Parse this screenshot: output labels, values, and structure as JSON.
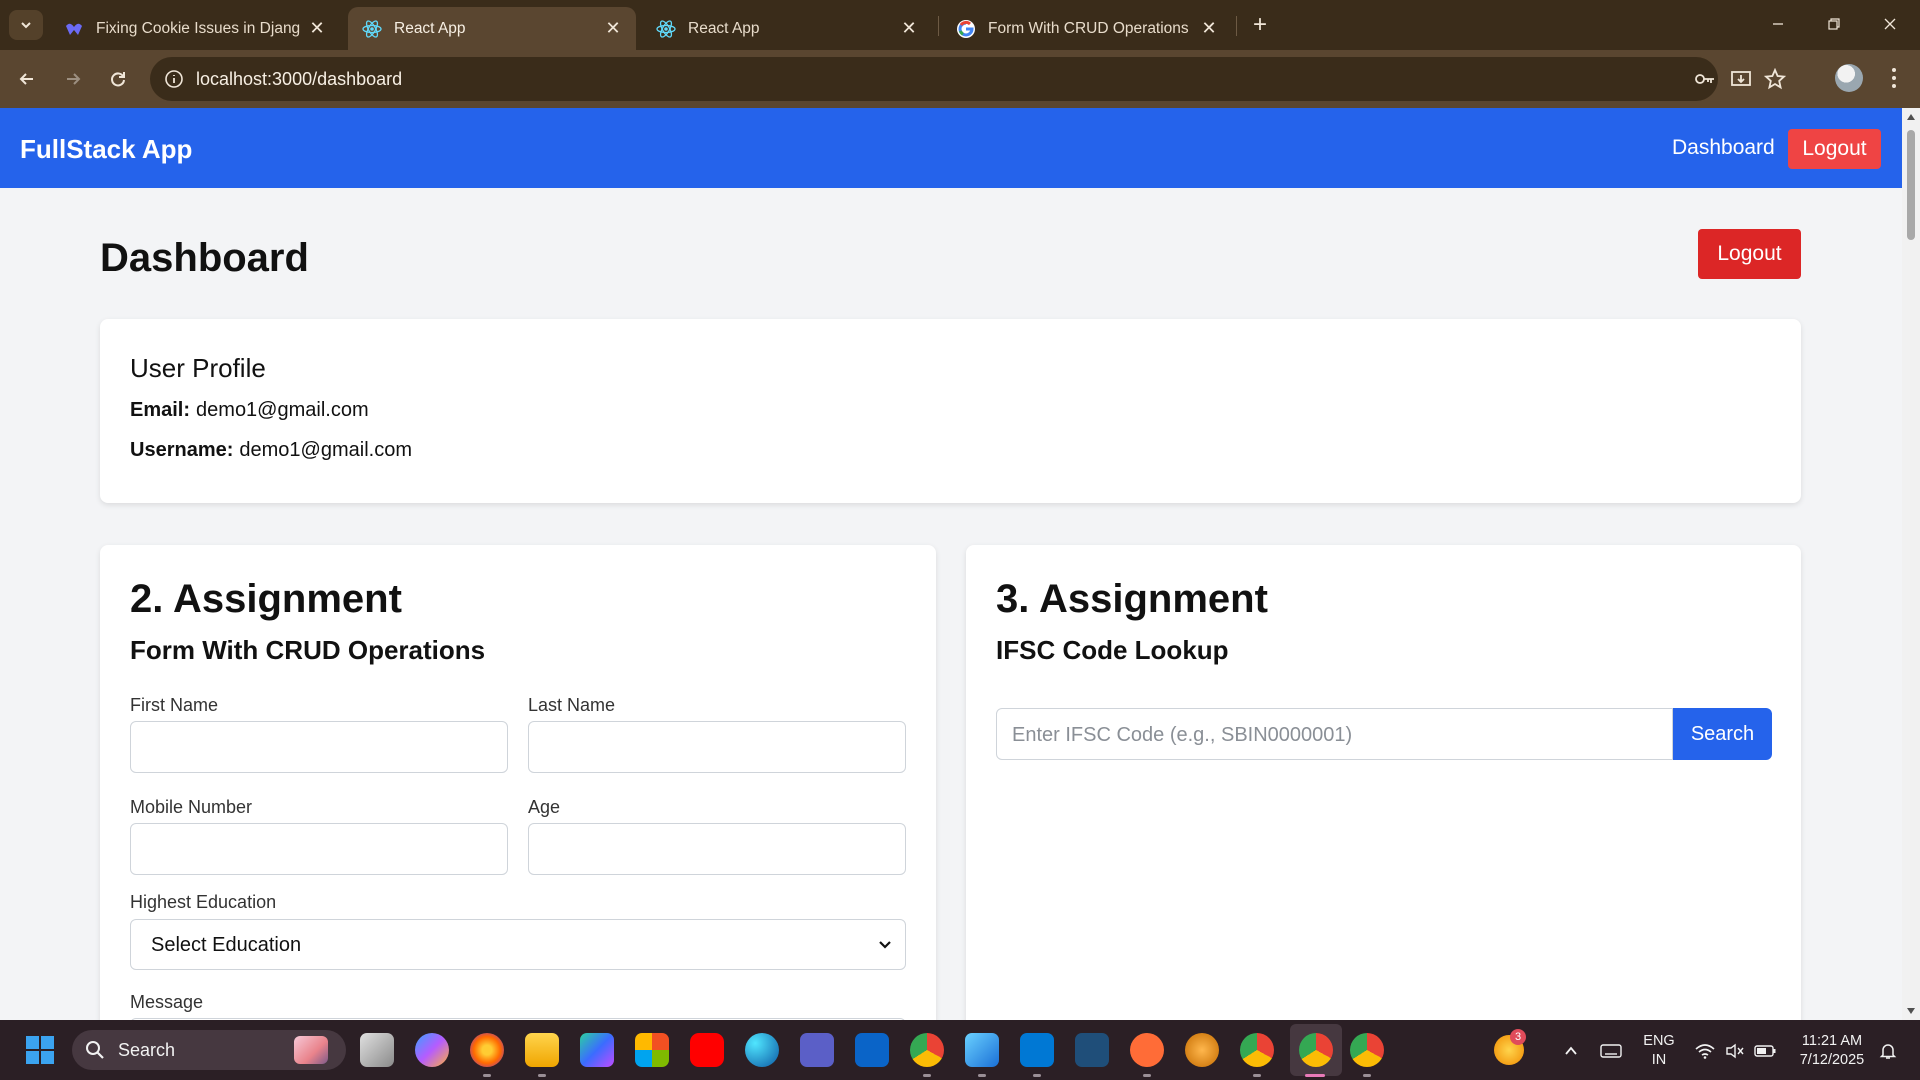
{
  "browser": {
    "tabs": [
      {
        "title": "Fixing Cookie Issues in Django",
        "icon": "devto-icon",
        "active": false
      },
      {
        "title": "React App",
        "icon": "react-icon",
        "active": true
      },
      {
        "title": "React App",
        "icon": "react-icon",
        "active": false
      },
      {
        "title": "Form With CRUD Operations -",
        "icon": "google-icon",
        "active": false
      }
    ],
    "url": "localhost:3000/dashboard"
  },
  "nav": {
    "brand": "FullStack App",
    "dashboard_link": "Dashboard",
    "logout": "Logout"
  },
  "page": {
    "title": "Dashboard",
    "logout": "Logout"
  },
  "profile": {
    "heading": "User Profile",
    "email_label": "Email:",
    "email": "demo1@gmail.com",
    "username_label": "Username:",
    "username": "demo1@gmail.com"
  },
  "assignment2": {
    "heading": "2. Assignment",
    "subheading": "Form With CRUD Operations",
    "first_name_label": "First Name",
    "last_name_label": "Last Name",
    "mobile_label": "Mobile Number",
    "age_label": "Age",
    "education_label": "Highest Education",
    "education_value": "Select Education",
    "message_label": "Message"
  },
  "assignment3": {
    "heading": "3. Assignment",
    "subheading": "IFSC Code Lookup",
    "ifsc_placeholder": "Enter IFSC Code (e.g., SBIN0000001)",
    "search_button": "Search"
  },
  "taskbar": {
    "search": "Search",
    "notification_count": "3",
    "language": "ENG",
    "region": "IN",
    "time": "11:21 AM",
    "date": "7/12/2025"
  },
  "colors": {
    "primary": "#2563eb",
    "danger": "#dc2626",
    "nav_logout": "#ef4444",
    "page_bg": "#f3f4f6"
  }
}
